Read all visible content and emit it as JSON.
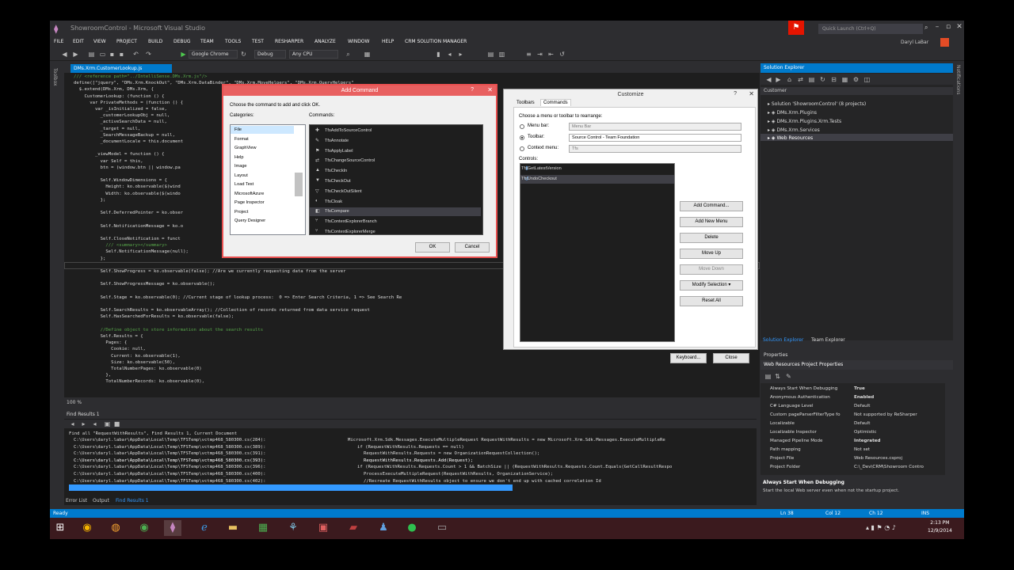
{
  "window": {
    "title": "ShowroomControl - Microsoft Visual Studio",
    "quick_launch_placeholder": "Quick Launch (Ctrl+Q)",
    "user_name": "Daryl LaBar"
  },
  "menu": [
    "FILE",
    "EDIT",
    "VIEW",
    "PROJECT",
    "BUILD",
    "DEBUG",
    "TEAM",
    "TOOLS",
    "TEST",
    "RESHARPER",
    "ANALYZE",
    "WINDOW",
    "HELP",
    "CRM SOLUTION MANAGER"
  ],
  "toolbar": {
    "browser": "Google Chrome",
    "configuration": "Debug",
    "platform": "Any CPU"
  },
  "editor": {
    "tab_label": "DMs.Xrm.CustomerLookup.js",
    "zoom": "100 %",
    "lines": [
      "/// <reference path=\"../IntelliSense.DMs.Xrm.js\"/>",
      "define([\"jquery\", \"DMs.Xrm.KnockOut\", \"DMs.Xrm.DataBinder\", \"DMs.Xrm.MoveHelpers\", \"DMs.Xrm.QueryHelpers\"",
      "  $.extend(DMs.Xrm, DMs.Xrm, {",
      "    CustomerLookup: (function () {",
      "      var PrivateMethods = (function () {",
      "        var _isInitialized = false,",
      "          _customerLookupObj = null,",
      "          _activeSearchData = null,",
      "          _target = null,",
      "          _SearchMessageBackup = null,",
      "          _documentLocale = this.document",
      "",
      "        _viewModel = function () {",
      "          var Self = this,",
      "          btn = (window.btn || window.pa",
      "",
      "          Self.WindowDimensions = {",
      "            Height: ko.observable($(wind",
      "            Width: ko.observable($(windo",
      "          };",
      "",
      "          Self.DeferredPointer = ko.obser",
      "",
      "          Self.NotificationMessage = ko.o",
      "",
      "          Self.CloseNotification = funct",
      "            /// <summary></summary>",
      "            Self.NotificationMessage(null);",
      "          };",
      "",
      "          Self.ShowProgress = ko.observable(false); //Are we currently requesting data from the server",
      "",
      "          Self.ShowProgressMessage = ko.observable();",
      "",
      "          Self.Stage = ko.observable(0); //Current stage of lookup process:  0 => Enter Search Criteria, 1 => See Search Re",
      "",
      "          Self.SearchResults = ko.observableArray(); //Collection of records returned from data service request",
      "          Self.HasSearchedForResults = ko.observable(false);",
      "",
      "          //Define object to store information about the search results",
      "          Self.Results = {",
      "            Pages: {",
      "              Cookie: null,",
      "              Current: ko.observable(1),",
      "              Size: ko.observable(50),",
      "              TotalNumberPages: ko.observable(0)",
      "            },",
      "            TotalNumberRecords: ko.observable(0),"
    ]
  },
  "find_results": {
    "title": "Find Results 1",
    "summary": "Find all \"RequestWithResults\", Find Results 1, Current Document",
    "rows": [
      {
        "file": "C:\\Users\\daryl.labar\\AppData\\Local\\Temp\\TFSTemp\\vctmp468_580300.cs(284):",
        "text": "Microsoft.Xrm.Sdk.Messages.ExecuteMultipleRequest RequestWithResults = new Microsoft.Xrm.Sdk.Messages.ExecuteMultipleRe"
      },
      {
        "file": "C:\\Users\\daryl.labar\\AppData\\Local\\Temp\\TFSTemp\\vctmp468_580300.cs(389):",
        "text": "if (RequestWithResults.Requests == null)"
      },
      {
        "file": "C:\\Users\\daryl.labar\\AppData\\Local\\Temp\\TFSTemp\\vctmp468_580300.cs(391):",
        "text": "RequestWithResults.Requests = new OrganizationRequestCollection();"
      },
      {
        "file": "C:\\Users\\daryl.labar\\AppData\\Local\\Temp\\TFSTemp\\vctmp468_580300.cs(393):",
        "text": "RequestWithResults.Requests.Add(Request);"
      },
      {
        "file": "C:\\Users\\daryl.labar\\AppData\\Local\\Temp\\TFSTemp\\vctmp468_580300.cs(396):",
        "text": "if (RequestWithResults.Requests.Count > 1 && BatchSize || (RequestWithResults.Requests.Count.Equals(GetCallResultRespo"
      },
      {
        "file": "C:\\Users\\daryl.labar\\AppData\\Local\\Temp\\TFSTemp\\vctmp468_580300.cs(400):",
        "text": "ProcessExecuteMultipleRequest(RequestWithResults, OrganizationService);"
      },
      {
        "file": "C:\\Users\\daryl.labar\\AppData\\Local\\Temp\\TFSTemp\\vctmp468_580300.cs(402):",
        "text": "//Recreate RequestWithResults object to ensure we don't end up with cached correlation Id"
      }
    ],
    "tabs": [
      "Error List",
      "Output",
      "Find Results 1"
    ]
  },
  "status": {
    "left": "Ready",
    "ln": "Ln 38",
    "col": "Col 12",
    "ch": "Ch 12",
    "mode": "INS"
  },
  "clock": {
    "time": "2:13 PM",
    "date": "12/9/2014"
  },
  "solution_explorer": {
    "title": "Solution Explorer",
    "search": "Customer",
    "items": [
      "Solution 'ShowroomControl' (8 projects)",
      "DMs.Xrm.Plugins",
      "DMs.Xrm.Plugins.Xrm.Tests",
      "DMs.Xrm.Services",
      "Web Resources"
    ],
    "tabs": [
      "Solution Explorer",
      "Team Explorer"
    ]
  },
  "properties": {
    "title": "Properties",
    "object": "Web Resources  Project Properties",
    "rows": [
      [
        "Always Start When Debugging",
        "True"
      ],
      [
        "Anonymous Authentication",
        "Enabled"
      ],
      [
        "C# Language Level",
        "Default"
      ],
      [
        "Custom pageParserFilterType fo",
        "Not supported by ReSharper"
      ],
      [
        "Localizable",
        "Default"
      ],
      [
        "Localizable Inspector",
        "Optimistic"
      ],
      [
        "Managed Pipeline Mode",
        "Integrated"
      ],
      [
        "Path mapping",
        "Not set"
      ],
      [
        "Project File",
        "Web Resources.csproj"
      ],
      [
        "Project Folder",
        "C:\\_Dev\\CRM\\Showroom Contro"
      ]
    ],
    "desc_title": "Always Start When Debugging",
    "desc": "Start the local Web server even when not the startup project."
  },
  "add_command": {
    "title": "Add Command",
    "prompt": "Choose the command to add and click OK.",
    "categories_label": "Categories:",
    "commands_label": "Commands:",
    "categories": [
      "File",
      "Format",
      "GraphView",
      "Help",
      "Image",
      "Layout",
      "Load Test",
      "MicrosoftAzure",
      "Page Inspector",
      "Project",
      "Query Designer"
    ],
    "commands": [
      "TfsAddToSourceControl",
      "TfsAnnotate",
      "TfsApplyLabel",
      "TfsChangeSourceControl",
      "TfsCheckIn",
      "TfsCheckOut",
      "TfsCheckOutSilent",
      "TfsCloak",
      "TfsCompare",
      "TfsContextExplorerBranch",
      "TfsContextExplorerMerge"
    ],
    "ok": "OK",
    "cancel": "Cancel"
  },
  "customize": {
    "title": "Customize",
    "tabs": [
      "Toolbars",
      "Commands"
    ],
    "choose_label": "Choose a menu or toolbar to rearrange:",
    "menu_bar_label": "Menu bar:",
    "menu_bar_value": "Menu Bar",
    "toolbar_label": "Toolbar:",
    "toolbar_value": "Source Control - Team Foundation",
    "context_label": "Context menu:",
    "context_value": "Tfs",
    "controls_label": "Controls:",
    "controls": [
      "TfsGetLatestVersion",
      "TfsUndoCheckout"
    ],
    "buttons": [
      "Add Command...",
      "Add New Menu",
      "Delete",
      "Move Up",
      "Move Down",
      "Modify Selection ▾",
      "Reset All"
    ],
    "keyboard": "Keyboard...",
    "close": "Close"
  }
}
